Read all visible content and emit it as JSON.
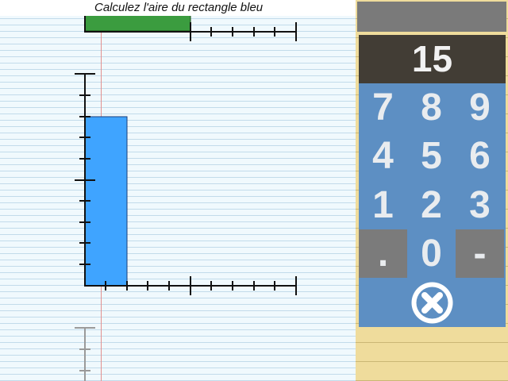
{
  "instruction": "Calculez l'aire du rectangle bleu",
  "display": {
    "value": "15"
  },
  "keypad": {
    "keys": [
      "7",
      "8",
      "9",
      "4",
      "5",
      "6",
      "1",
      "2",
      "3",
      ".",
      "0",
      "-"
    ],
    "clear_icon": "circle-x-icon"
  },
  "colors": {
    "blue_rectangle": "#3fa4ff",
    "green_rectangle": "#3b9c3f",
    "keypad_bg": "#5d8fc3",
    "display_bg": "#423d35",
    "grey_key": "#7b7b7b",
    "side_paper": "#efdc9c",
    "notebook_lines": "#c2dbea",
    "margin_line": "#e2908f"
  },
  "shapes": {
    "blue_rectangle": {
      "width_units": 2,
      "height_units": 8
    }
  }
}
